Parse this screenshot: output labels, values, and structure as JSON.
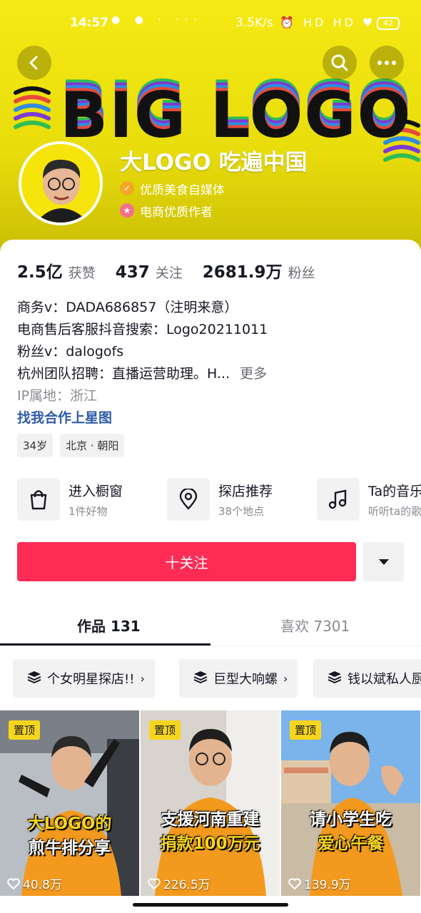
{
  "status_bar": {
    "time": "14:57",
    "dots": "● ● · ···",
    "network": "3.5K/s",
    "icons": "⏰ HD HD ♥",
    "battery": "42"
  },
  "header": {
    "banner_text": "BIG LOGO",
    "name": "大LOGO 吃遍中国",
    "cert_1": "优质美食自媒体",
    "cert_2": "电商优质作者",
    "colors": {
      "background": "#f5ea13",
      "cert_1_icon": "#f5a623",
      "cert_2_icon": "#f36f8f"
    }
  },
  "stats": [
    {
      "value": "2.5亿",
      "label": "获赞"
    },
    {
      "value": "437",
      "label": "关注"
    },
    {
      "value": "2681.9万",
      "label": "粉丝"
    }
  ],
  "bio": {
    "line_1": "商务v：DADA686857（注明来意）",
    "line_2": "电商售后客服抖音搜索：Logo20211011",
    "line_3": "粉丝v：dalogofs",
    "line_4": "杭州团队招聘：直播运营助理。H...",
    "more": "更多",
    "ip": "IP属地：浙江",
    "star_link": "找我合作上星图"
  },
  "tags": [
    "34岁",
    "北京 · 朝阳"
  ],
  "features": [
    {
      "title": "进入橱窗",
      "subtitle": "1件好物",
      "icon": "shopping-bag-icon"
    },
    {
      "title": "探店推荐",
      "subtitle": "38个地点",
      "icon": "location-pin-icon"
    },
    {
      "title": "Ta的音乐",
      "subtitle": "听听ta的歌",
      "icon": "music-note-icon"
    }
  ],
  "follow": {
    "label": "十关注",
    "color": "#fe2c55"
  },
  "tabs": {
    "works": "作品 131",
    "likes": "喜欢 7301"
  },
  "collections": [
    {
      "label": "个女明星探店!!"
    },
    {
      "label": "巨型大响螺"
    },
    {
      "label": "钱以斌私人厨"
    }
  ],
  "videos": [
    {
      "pin": "置顶",
      "caption_1": "大LOGO的",
      "caption_2": "煎牛排分享",
      "likes": "40.8万"
    },
    {
      "pin": "置顶",
      "caption_1": "支援河南重建",
      "caption_2": "捐款100万元",
      "likes": "226.5万"
    },
    {
      "pin": "置顶",
      "caption_1": "请小学生吃",
      "caption_2": "爱心午餐",
      "likes": "139.9万"
    }
  ]
}
